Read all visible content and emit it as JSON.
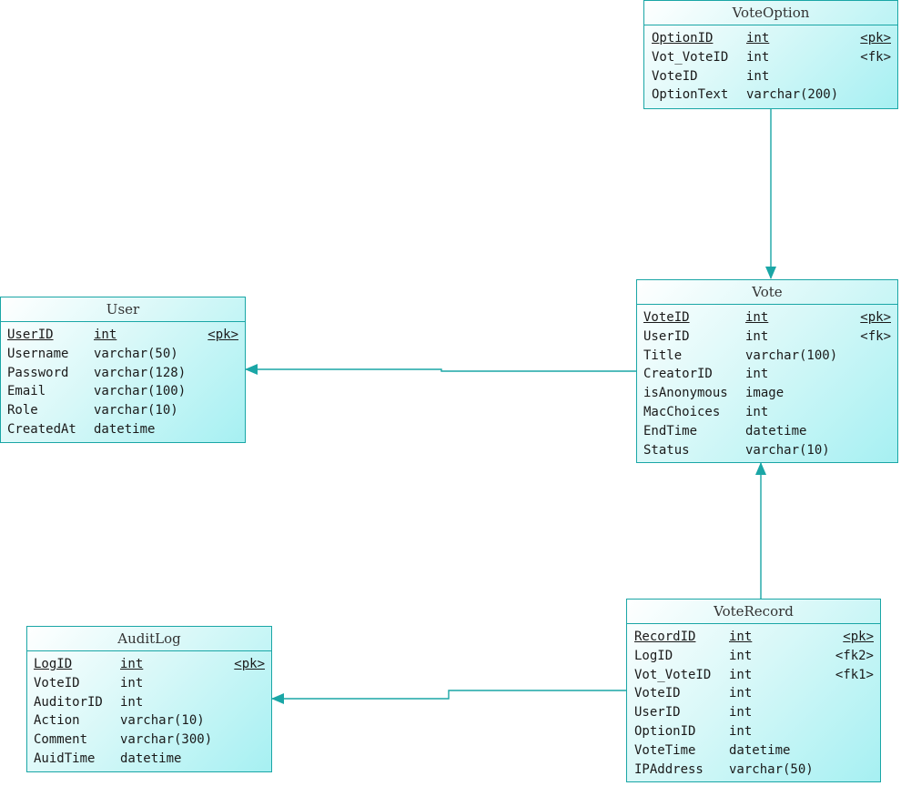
{
  "colors": {
    "line": "#1aa6a6",
    "fill_start": "#ffffff",
    "fill_end": "#a6f0f2"
  },
  "entities": {
    "voteoption": {
      "title": "VoteOption",
      "attrs": [
        {
          "name": "OptionID",
          "type": "int",
          "key": "<pk>"
        },
        {
          "name": "Vot_VoteID",
          "type": "int",
          "key": "<fk>"
        },
        {
          "name": "VoteID",
          "type": "int",
          "key": ""
        },
        {
          "name": "OptionText",
          "type": "varchar(200)",
          "key": ""
        }
      ]
    },
    "user": {
      "title": "User",
      "attrs": [
        {
          "name": "UserID",
          "type": "int",
          "key": "<pk>"
        },
        {
          "name": "Username",
          "type": "varchar(50)",
          "key": ""
        },
        {
          "name": "Password",
          "type": "varchar(128)",
          "key": ""
        },
        {
          "name": "Email",
          "type": "varchar(100)",
          "key": ""
        },
        {
          "name": "Role",
          "type": "varchar(10)",
          "key": ""
        },
        {
          "name": "CreatedAt",
          "type": "datetime",
          "key": ""
        }
      ]
    },
    "vote": {
      "title": "Vote",
      "attrs": [
        {
          "name": "VoteID",
          "type": "int",
          "key": "<pk>"
        },
        {
          "name": "UserID",
          "type": "int",
          "key": "<fk>"
        },
        {
          "name": "Title",
          "type": "varchar(100)",
          "key": ""
        },
        {
          "name": "CreatorID",
          "type": "int",
          "key": ""
        },
        {
          "name": "isAnonymous",
          "type": "image",
          "key": ""
        },
        {
          "name": "MacChoices",
          "type": "int",
          "key": ""
        },
        {
          "name": "EndTime",
          "type": "datetime",
          "key": ""
        },
        {
          "name": "Status",
          "type": "varchar(10)",
          "key": ""
        }
      ]
    },
    "auditlog": {
      "title": "AuditLog",
      "attrs": [
        {
          "name": "LogID",
          "type": "int",
          "key": "<pk>"
        },
        {
          "name": "VoteID",
          "type": "int",
          "key": ""
        },
        {
          "name": "AuditorID",
          "type": "int",
          "key": ""
        },
        {
          "name": "Action",
          "type": "varchar(10)",
          "key": ""
        },
        {
          "name": "Comment",
          "type": "varchar(300)",
          "key": ""
        },
        {
          "name": "AuidTime",
          "type": "datetime",
          "key": ""
        }
      ]
    },
    "voterecord": {
      "title": "VoteRecord",
      "attrs": [
        {
          "name": "RecordID",
          "type": "int",
          "key": "<pk>"
        },
        {
          "name": "LogID",
          "type": "int",
          "key": "<fk2>"
        },
        {
          "name": "Vot_VoteID",
          "type": "int",
          "key": "<fk1>"
        },
        {
          "name": "VoteID",
          "type": "int",
          "key": ""
        },
        {
          "name": "UserID",
          "type": "int",
          "key": ""
        },
        {
          "name": "OptionID",
          "type": "int",
          "key": ""
        },
        {
          "name": "VoteTime",
          "type": "datetime",
          "key": ""
        },
        {
          "name": "IPAddress",
          "type": "varchar(50)",
          "key": ""
        }
      ]
    }
  }
}
